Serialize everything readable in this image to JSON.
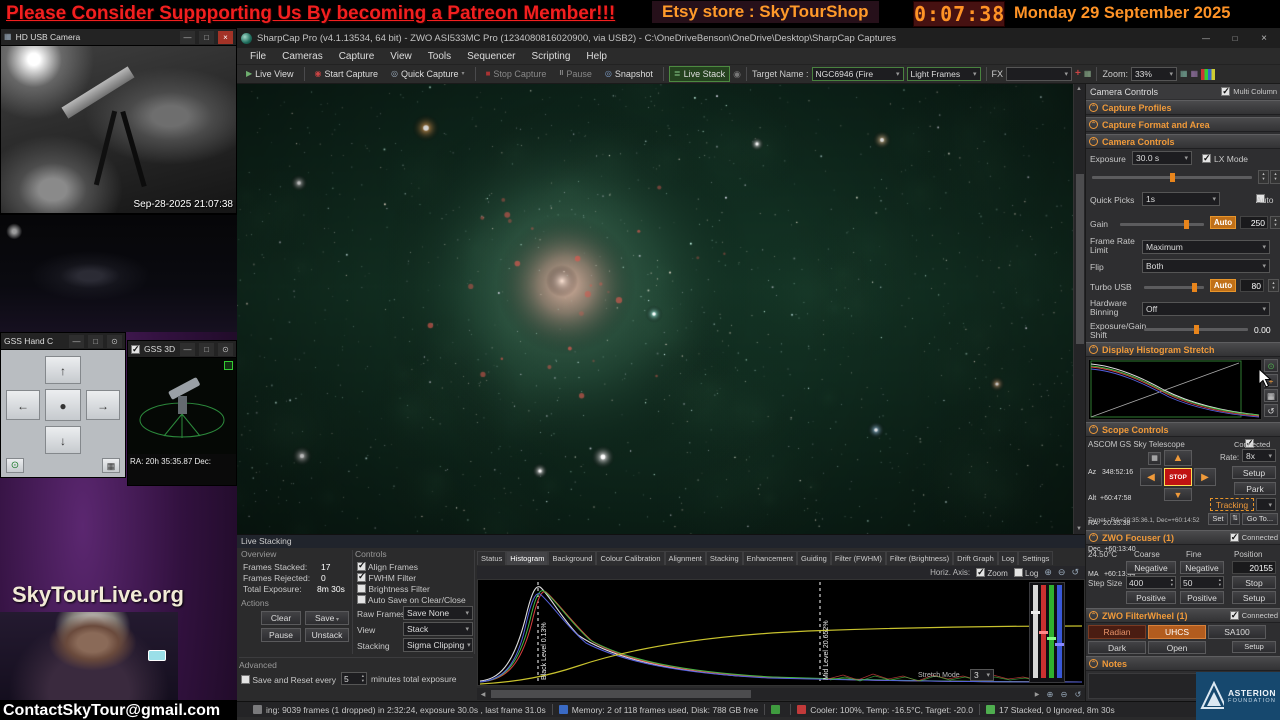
{
  "accent": {
    "orange": "#f09a3a",
    "green": "#3f9b3f",
    "red": "#cc2020",
    "logo_blue": "#16486e"
  },
  "icons": {
    "minimize": "—",
    "maximize": "□",
    "close": "×",
    "up": "▲",
    "down": "▼",
    "left": "◀",
    "right": "▶",
    "aup": "↑",
    "adn": "↓",
    "alt": "←",
    "art": "→",
    "power": "⊙",
    "grid": "▦",
    "zin": "⊕",
    "zout": "⊖",
    "reset": "↺",
    "play": "▶",
    "record": "◉",
    "stopsq": "■",
    "pause": "II",
    "snap": "◎",
    "stack": "≣",
    "cross": "+",
    "center": "●",
    "updown": "⇅"
  },
  "banner": {
    "patreon": "Please Consider Suppporting Us By becoming a Patreon Member!!!",
    "etsy": "Etsy store : SkyTourShop",
    "timer": "0:07:38",
    "date": "Monday 29 September 2025"
  },
  "left_column": {
    "hd_camera": {
      "title": "HD USB Camera",
      "timestamp": "Sep-28-2025 21:07:38"
    },
    "gss_hand": {
      "title": "GSS Hand C"
    },
    "gss_3d": {
      "title": "GSS 3D",
      "coords": "RA: 20h 35:35.87  Dec:"
    },
    "brand": "SkyTourLive.org",
    "contact": "ContactSkyTour@gmail.com"
  },
  "sharpcap": {
    "window_title": "SharpCap Pro (v4.1.13534, 64 bit) - ZWO ASI533MC Pro (1234080816020900, via USB2) - C:\\OneDriveBenson\\OneDrive\\Desktop\\SharpCap Captures",
    "menus": [
      "File",
      "Cameras",
      "Capture",
      "View",
      "Tools",
      "Sequencer",
      "Scripting",
      "Help"
    ],
    "toolbar": {
      "live_view": "Live View",
      "start_capture": "Start Capture",
      "quick_capture": "Quick Capture",
      "stop_capture": "Stop Capture",
      "pause": "Pause",
      "snapshot": "Snapshot",
      "live_stack": "Live Stack",
      "target_name_label": "Target Name :",
      "target_name_value": "NGC6946 (Fire",
      "frame_type": "Light Frames",
      "fx_label": "FX",
      "zoom_label": "Zoom:",
      "zoom_value": "33%"
    },
    "status_bar": {
      "capture": "ing: 9039 frames (1 dropped) in 2:32:24, exposure 30.0s , last frame 31.0s",
      "memory": "Memory: 2 of 118 frames used, Disk: 788 GB free",
      "cooler": "Cooler: 100%, Temp: -16.5°C, Target: -20.0",
      "stacked": "17 Stacked, 0 Ignored, 8m 30s"
    }
  },
  "live_stacking": {
    "title": "Live Stacking",
    "overview": {
      "label": "Overview",
      "frames_stacked_label": "Frames Stacked:",
      "frames_stacked": "17",
      "frames_rejected_label": "Frames Rejected:",
      "frames_rejected": "0",
      "total_exposure_label": "Total Exposure:",
      "total_exposure": "8m 30s"
    },
    "actions": {
      "label": "Actions",
      "clear": "Clear",
      "save": "Save",
      "pause": "Pause",
      "unstack": "Unstack"
    },
    "controls": {
      "label": "Controls",
      "align_frames": "Align Frames",
      "fwhm_filter": "FWHM Filter",
      "brightness_filter": "Brightness Filter",
      "auto_save": "Auto Save on Clear/Close",
      "raw_frames_label": "Raw Frames",
      "raw_frames_value": "Save None",
      "view_label": "View",
      "view_value": "Stack",
      "stacking_label": "Stacking",
      "stacking_value": "Sigma Clipping"
    },
    "advanced": {
      "label": "Advanced",
      "prefix": "Save and Reset every",
      "value": "5",
      "suffix": "minutes total exposure"
    },
    "tabs": [
      "Status",
      "Histogram",
      "Background",
      "Colour Calibration",
      "Alignment",
      "Stacking",
      "Enhancement",
      "Guiding",
      "Filter (FWHM)",
      "Filter (Brightness)",
      "Drift Graph",
      "Log",
      "Settings"
    ],
    "histogram": {
      "horiz_axis_label": "Horiz. Axis:",
      "zoom_label": "Zoom",
      "log_label": "Log",
      "black_level_label": "Black Level 0.13%",
      "mid_level_label": "Mid Level 20.652%",
      "stretch_mode_label": "Stretch Mode",
      "stretch_mode_value": "3"
    }
  },
  "right_panel": {
    "header": "Camera Controls",
    "multi_column": "Multi Column",
    "sections": {
      "capture_profiles": "Capture Profiles",
      "capture_format": "Capture Format and Area",
      "camera_controls": "Camera Controls",
      "display_stretch": "Display Histogram Stretch",
      "scope_controls": "Scope Controls",
      "focuser": "ZWO Focuser (1)",
      "filterwheel": "ZWO FilterWheel (1)",
      "notes": "Notes"
    },
    "camera": {
      "exposure_label": "Exposure",
      "exposure_value": "30.0 s",
      "lx_mode": "LX Mode",
      "quick_picks_label": "Quick Picks",
      "quick_picks_value": "1s",
      "auto_label": "Auto",
      "gain_label": "Gain",
      "gain_auto": "Auto",
      "gain_value": "250",
      "frame_rate_label": "Frame Rate Limit",
      "frame_rate_value": "Maximum",
      "flip_label": "Flip",
      "flip_value": "Both",
      "turbo_usb_label": "Turbo USB",
      "turbo_usb_auto": "Auto",
      "turbo_usb_value": "80",
      "hw_binning_label": "Hardware Binning",
      "hw_binning_value": "Off",
      "exp_gain_shift_label": "Exposure/Gain Shift",
      "exp_gain_shift_value": "0.00"
    },
    "scope": {
      "driver": "ASCOM GS Sky Telescope",
      "connected": "Connected",
      "az": "Az   348:52:16",
      "alt": "Alt  +60:47:58",
      "ra": "RA   20:35:38",
      "dec": "Dec  +60:13:40",
      "ma": "MA   +60:13:44",
      "rate_label": "Rate:",
      "rate_value": "8x",
      "stop": "STOP",
      "setup": "Setup",
      "park": "Park",
      "tracking": "Tracking",
      "target_line": "Target : RA=20:35:36.1, Dec=+60:14:52",
      "set": "Set",
      "goto": "Go To..."
    },
    "focuser": {
      "temp": "24.50°C",
      "coarse": "Coarse",
      "fine": "Fine",
      "position_label": "Position",
      "negative": "Negative",
      "position_value": "20155",
      "step_size_label": "Step Size",
      "step_coarse": "400",
      "step_fine": "50",
      "stop": "Stop",
      "positive": "Positive",
      "setup": "Setup",
      "connected": "Connected"
    },
    "filterwheel": {
      "connected": "Connected",
      "radian": "Radian",
      "uhcs": "UHCS",
      "sa100": "SA100",
      "dark": "Dark",
      "open": "Open",
      "setup": "Setup"
    }
  },
  "asterion": {
    "line1": "ASTERION",
    "line2": "FOUNDATION"
  }
}
